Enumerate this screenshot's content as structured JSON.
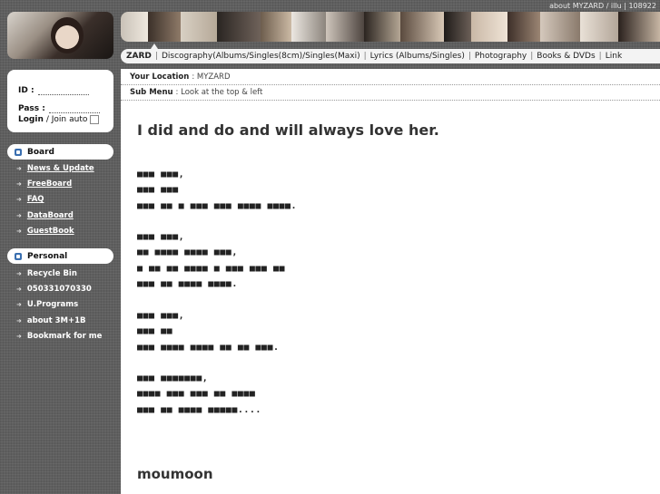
{
  "header": {
    "top_links": "about MYZARD / illu | 108922",
    "nav": [
      "ZARD",
      "Discography(Albums/Singles(8cm)/Singles(Maxi)",
      "Lyrics (Albums/Singles)",
      "Photography",
      "Books & DVDs",
      "Link"
    ]
  },
  "login": {
    "id_label": "ID :",
    "pass_label": "Pass :",
    "login_label": "Login",
    "join_label": "/ Join",
    "auto_label": "auto"
  },
  "sidebar": {
    "board": {
      "title": "Board",
      "items": [
        "News & Update",
        "FreeBoard",
        "FAQ",
        "DataBoard",
        "GuestBook"
      ]
    },
    "personal": {
      "title": "Personal",
      "items": [
        "Recycle Bin",
        "050331070330",
        "U.Programs",
        "about 3M+1B",
        "Bookmark for me"
      ]
    }
  },
  "location": {
    "label": "Your Location",
    "value": ": MYZARD"
  },
  "submenu": {
    "label": "Sub Menu",
    "value": ": Look at the top & left"
  },
  "post": {
    "title": "I did and do and will always love her.",
    "stanzas": [
      [
        "■■■ ■■■,",
        "■■■ ■■■",
        "■■■ ■■ ■ ■■■ ■■■ ■■■■ ■■■■."
      ],
      [
        "■■■ ■■■,",
        "■■ ■■■■ ■■■■ ■■■,",
        "■ ■■ ■■ ■■■■ ■ ■■■ ■■■ ■■",
        "■■■ ■■ ■■■■ ■■■■."
      ],
      [
        "■■■ ■■■,",
        "■■■ ■■",
        "■■■ ■■■■ ■■■■ ■■ ■■ ■■■."
      ],
      [
        "■■■ ■■■■■■■,",
        "■■■■ ■■■ ■■■ ■■ ■■■■",
        "■■■ ■■ ■■■■ ■■■■■...."
      ]
    ],
    "signature": "moumoon"
  }
}
